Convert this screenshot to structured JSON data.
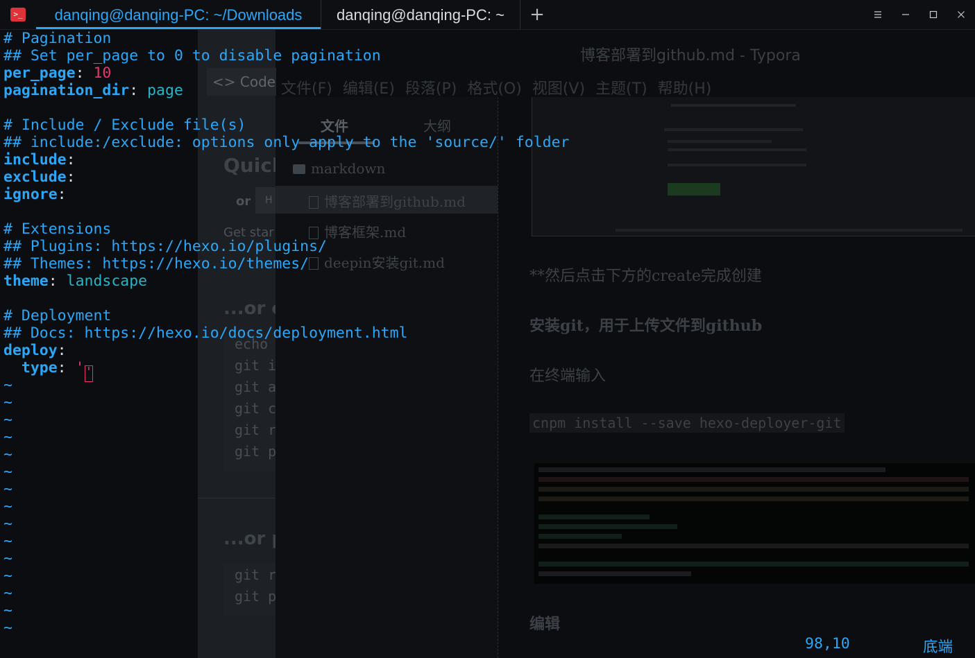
{
  "terminal": {
    "tabs": [
      {
        "label": "danqing@danqing-PC: ~/Downloads",
        "active": true
      },
      {
        "label": "danqing@danqing-PC: ~",
        "active": false
      }
    ],
    "add_tab_icon": "plus-icon",
    "window_controls": [
      "menu-icon",
      "minimize-icon",
      "maximize-icon",
      "close-icon"
    ],
    "accent_color": "#2ca7f8",
    "lines": {
      "l1": "# Pagination",
      "l2": "## Set per_page to 0 to disable pagination",
      "l3_key": "per_page",
      "l3_sep": ": ",
      "l3_val": "10",
      "l4_key": "pagination_dir",
      "l4_sep": ": ",
      "l4_val": "page",
      "l6": "# Include / Exclude file(s)",
      "l7": "## include:/exclude: options only apply to the 'source/' folder",
      "l8_key": "include",
      "l8_sep": ":",
      "l9_key": "exclude",
      "l9_sep": ":",
      "l10_key": "ignore",
      "l10_sep": ":",
      "l12": "# Extensions",
      "l13": "## Plugins: https://hexo.io/plugins/",
      "l14": "## Themes: https://hexo.io/themes/",
      "l15_key": "theme",
      "l15_sep": ": ",
      "l15_val": "landscape",
      "l17": "# Deployment",
      "l18": "## Docs: https://hexo.io/docs/deployment.html",
      "l19_key": "deploy",
      "l19_sep": ":",
      "l20_indent": "  ",
      "l20_key": "type",
      "l20_sep": ": ",
      "l20_quote": "'",
      "l20_cursor": "'"
    },
    "empty_line_marker": "~",
    "status_position": "98,10",
    "status_scroll": "底端"
  },
  "background": {
    "left_window": {
      "code_button": "Code",
      "quick": "Quick",
      "or_label": "or",
      "ht": "H",
      "get_started": "Get star",
      "or_c": "...or c",
      "code_lines": [
        "echo",
        "git i",
        "git a",
        "git c",
        "git r",
        "git p"
      ],
      "or_p": "...or p",
      "code_lines2": [
        "git r",
        "git p"
      ]
    },
    "typora": {
      "title": "博客部署到github.md - Typora",
      "menu": [
        "文件(F)",
        "编辑(E)",
        "段落(P)",
        "格式(O)",
        "视图(V)",
        "主题(T)",
        "帮助(H)"
      ],
      "sidebar_tabs": [
        "文件",
        "大纲"
      ],
      "folder": "markdown",
      "files": [
        "博客部署到github.md",
        "博客框架.md",
        "deepin安装git.md"
      ],
      "para1": "**然后点击下方的create完成创建",
      "heading1": "安装git，用于上传文件到github",
      "para2": "在终端输入",
      "code": "cnpm install --save hexo-deployer-git",
      "heading2": "编辑"
    }
  }
}
